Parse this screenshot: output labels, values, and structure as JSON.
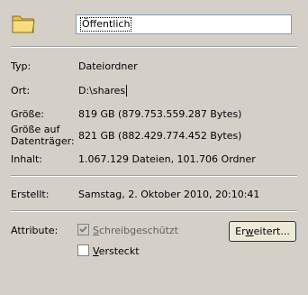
{
  "header": {
    "icon": "folder-icon",
    "name_value": "Öffentlich"
  },
  "properties": {
    "type_label": "Typ:",
    "type_value": "Dateiordner",
    "location_label": "Ort:",
    "location_value": "D:\\shares",
    "size_label": "Größe:",
    "size_value": "819 GB (879.753.559.287 Bytes)",
    "size_on_disk_label_line1": "Größe auf",
    "size_on_disk_label_line2": "Datenträger:",
    "size_on_disk_value": "821 GB (882.429.774.452 Bytes)",
    "contains_label": "Inhalt:",
    "contains_value": "1.067.129 Dateien, 101.706 Ordner"
  },
  "dates": {
    "created_label": "Erstellt:",
    "created_value": "Samstag, 2. Oktober 2010, 20:10:41"
  },
  "attributes": {
    "label": "Attribute:",
    "readonly_pre": "",
    "readonly_accel": "S",
    "readonly_rest": "chreibgeschützt",
    "readonly_checked": true,
    "hidden_accel": "V",
    "hidden_rest": "ersteckt",
    "hidden_checked": false,
    "advanced_pre": "Er",
    "advanced_accel": "w",
    "advanced_rest": "eitert..."
  },
  "colors": {
    "dialog_background": "#d4d0c8",
    "input_border": "#7f9db9",
    "button_border": "#003c74",
    "disabled_text": "#5f5f5f"
  }
}
